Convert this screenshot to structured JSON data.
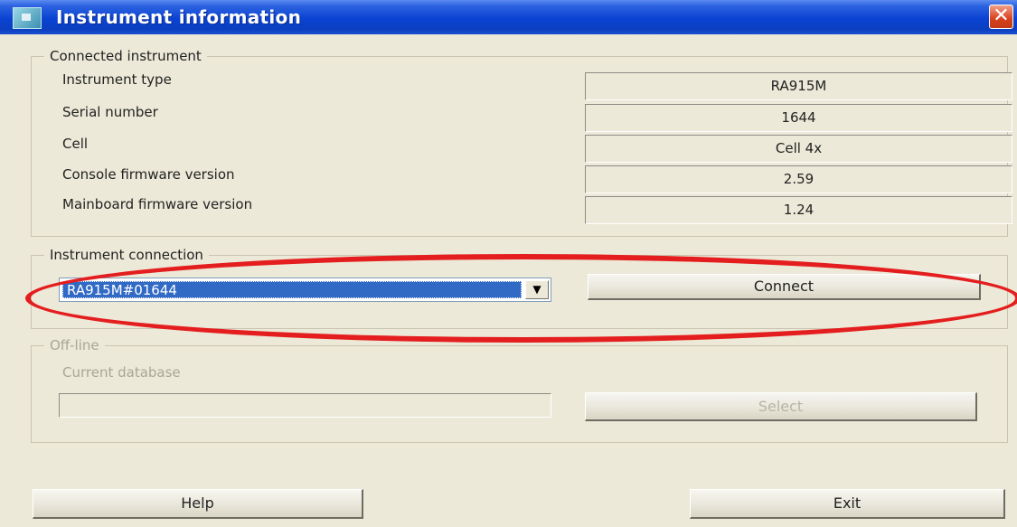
{
  "window": {
    "title": "Instrument information",
    "close_glyph": "✕"
  },
  "connected_instrument": {
    "legend": "Connected instrument",
    "rows": [
      {
        "label": "Instrument type",
        "value": "RA915M"
      },
      {
        "label": "Serial number",
        "value": "1644"
      },
      {
        "label": "Cell",
        "value": "Cell 4x"
      },
      {
        "label": "Console firmware version",
        "value": "2.59"
      },
      {
        "label": "Mainboard firmware version",
        "value": "1.24"
      }
    ]
  },
  "instrument_connection": {
    "legend": "Instrument connection",
    "selected_device": "RA915M#01644",
    "dropdown_arrow": "▼",
    "connect_label": "Connect"
  },
  "offline": {
    "legend": "Off-line",
    "database_label": "Current database",
    "database_value": "",
    "select_label": "Select"
  },
  "footer": {
    "help_label": "Help",
    "exit_label": "Exit"
  },
  "colors": {
    "titlebar": "#0a43d2",
    "selection": "#316ac5",
    "annotation": "#e41e1e"
  }
}
